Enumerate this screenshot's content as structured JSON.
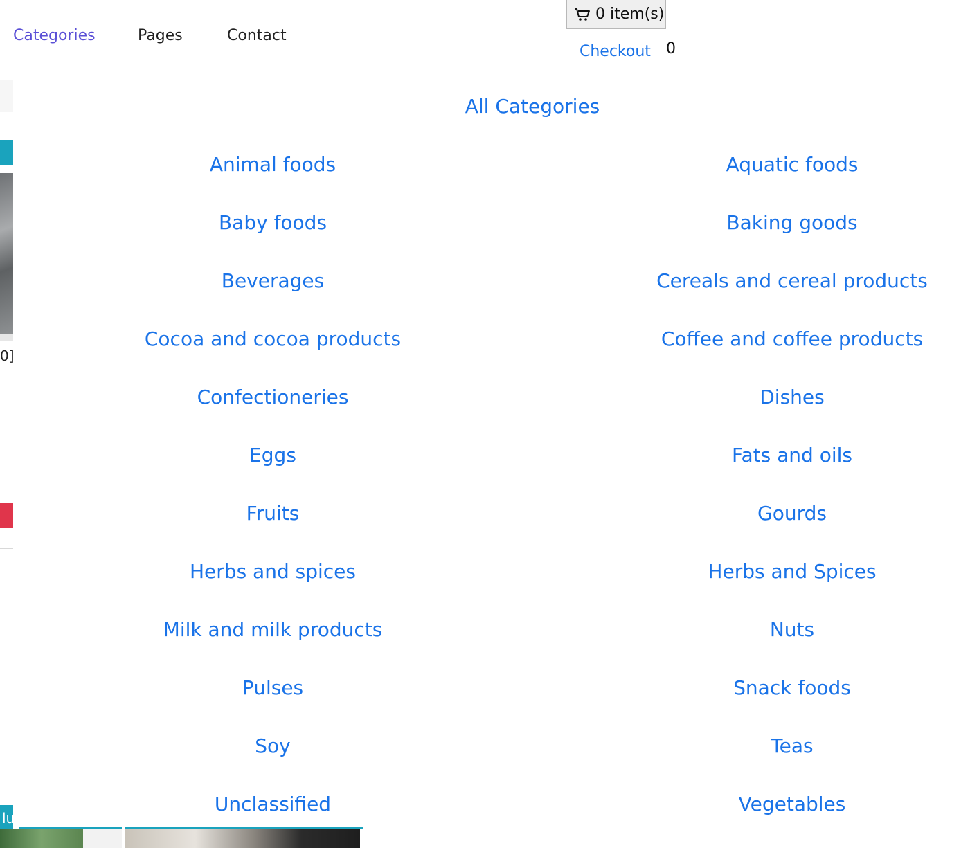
{
  "nav": {
    "items": [
      {
        "label": "Categories",
        "active": true
      },
      {
        "label": "Pages",
        "active": false
      },
      {
        "label": "Contact",
        "active": false
      }
    ]
  },
  "cart": {
    "icon": "cart-icon",
    "label": "0 item(s)"
  },
  "checkout": {
    "label": "Checkout",
    "count": "0"
  },
  "categories": {
    "heading": "All Categories",
    "items": [
      "Animal foods",
      "Aquatic foods",
      "Baby foods",
      "Baking goods",
      "Beverages",
      "Cereals and cereal products",
      "Cocoa and cocoa products",
      "Coffee and coffee products",
      "Confectioneries",
      "Dishes",
      "Eggs",
      "Fats and oils",
      "Fruits",
      "Gourds",
      "Herbs and spices",
      "Herbs and Spices",
      "Milk and milk products",
      "Nuts",
      "Pulses",
      "Snack foods",
      "Soy",
      "Teas",
      "Unclassified",
      "Vegetables"
    ]
  },
  "background": {
    "fragment_text": "0]",
    "fragment_bottom_text": "lu"
  },
  "colors": {
    "link": "#1a73e8",
    "nav_active": "#5a4fd6",
    "teal": "#1aa3bd",
    "red": "#e0354b"
  }
}
